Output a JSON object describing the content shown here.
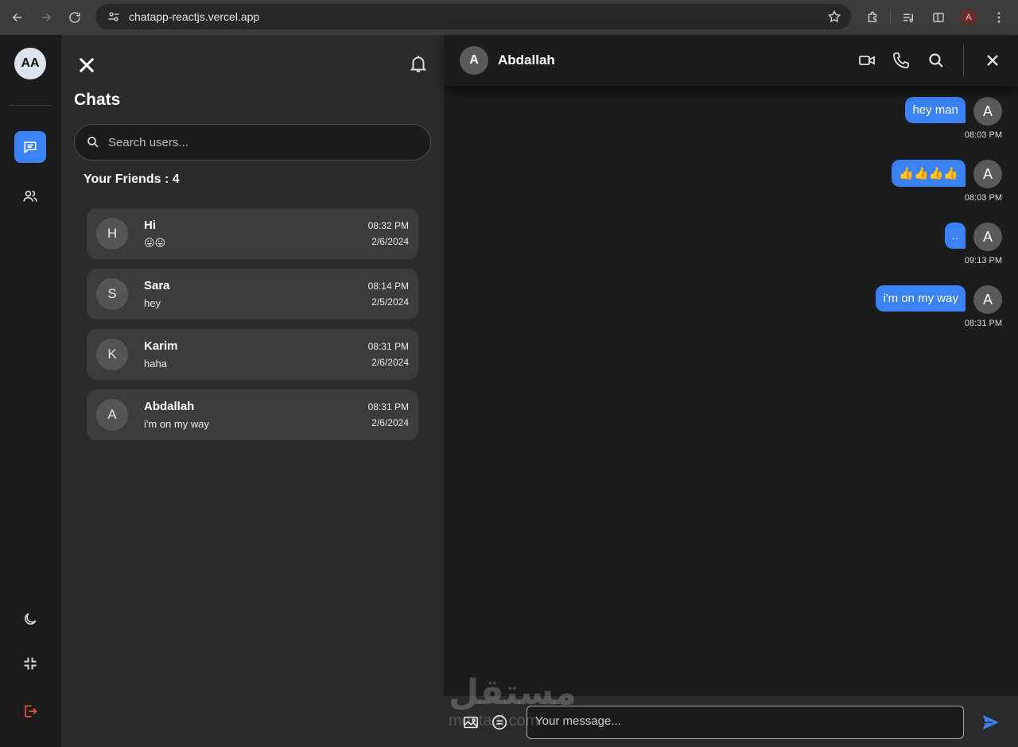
{
  "browser": {
    "url": "chatapp-reactjs.vercel.app",
    "profile_initial": "A"
  },
  "rail": {
    "avatar_initials": "AA"
  },
  "panel": {
    "title": "Chats",
    "search_placeholder": "Search users...",
    "friends_heading": "Your Friends : 4",
    "friends": [
      {
        "initial": "H",
        "name": "Hi",
        "last_message": "😛😛",
        "time": "08:32 PM",
        "date": "2/6/2024"
      },
      {
        "initial": "S",
        "name": "Sara",
        "last_message": "hey",
        "time": "08:14 PM",
        "date": "2/5/2024"
      },
      {
        "initial": "K",
        "name": "Karim",
        "last_message": "haha",
        "time": "08:31 PM",
        "date": "2/6/2024"
      },
      {
        "initial": "A",
        "name": "Abdallah",
        "last_message": "i'm on my way",
        "time": "08:31 PM",
        "date": "2/6/2024"
      }
    ]
  },
  "conversation": {
    "contact_initial": "A",
    "contact_name": "Abdallah",
    "messages": [
      {
        "text": "hey man",
        "time": "08:03 PM",
        "sender_initial": "A"
      },
      {
        "text": "👍👍👍👍",
        "time": "08:03 PM",
        "sender_initial": "A"
      },
      {
        "text": "..",
        "time": "09:13 PM",
        "sender_initial": "A"
      },
      {
        "text": "i'm on my way",
        "time": "08:31 PM",
        "sender_initial": "A"
      }
    ],
    "input_placeholder": "Your message..."
  },
  "watermark": {
    "text": "مستقل",
    "sub": "mostaql.com"
  },
  "colors": {
    "accent": "#3b82f6",
    "danger": "#e0553c"
  }
}
